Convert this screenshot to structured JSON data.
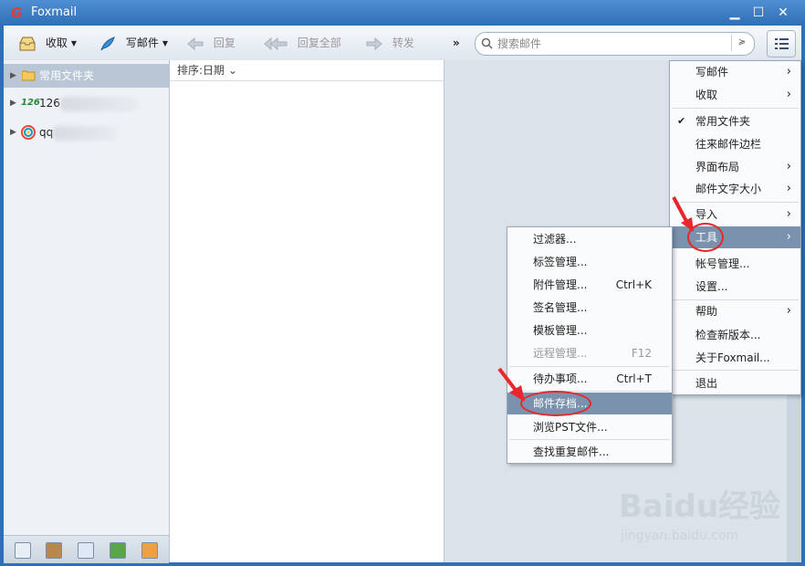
{
  "window": {
    "title": "Foxmail",
    "logo_glyph": "G",
    "controls": {
      "minimize": "▁",
      "maximize": "☐",
      "close": "✕"
    }
  },
  "toolbar": {
    "receive": "收取",
    "compose": "写邮件",
    "reply": "回复",
    "reply_all": "回复全部",
    "forward": "转发",
    "more": "»",
    "search_placeholder": "搜索邮件",
    "search_dropdown": "≽"
  },
  "folders": [
    {
      "label": "常用文件夹",
      "icon": "folder-icon",
      "selected": true
    },
    {
      "label": "126",
      "icon": "126-account-icon",
      "prefix": "126"
    },
    {
      "label": "qq",
      "icon": "qq-account-icon"
    }
  ],
  "list": {
    "sort_label": "排序:日期",
    "sort_caret": "⌄"
  },
  "main_menu": [
    {
      "label": "写邮件",
      "submenu": true
    },
    {
      "label": "收取",
      "submenu": true
    },
    {
      "label": "常用文件夹",
      "checked": true
    },
    {
      "label": "往来邮件边栏"
    },
    {
      "label": "界面布局",
      "submenu": true
    },
    {
      "label": "邮件文字大小",
      "submenu": true
    },
    {
      "label": "导入",
      "submenu": true
    },
    {
      "label": "工具",
      "submenu": true,
      "highlighted": true
    },
    {
      "label": "帐号管理..."
    },
    {
      "label": "设置..."
    },
    {
      "label": "帮助",
      "submenu": true
    },
    {
      "label": "检查新版本..."
    },
    {
      "label": "关于Foxmail..."
    },
    {
      "label": "退出"
    }
  ],
  "tools_menu": [
    {
      "label": "过滤器..."
    },
    {
      "label": "标签管理..."
    },
    {
      "label": "附件管理...",
      "shortcut": "Ctrl+K"
    },
    {
      "label": "签名管理..."
    },
    {
      "label": "模板管理..."
    },
    {
      "label": "远程管理...",
      "shortcut": "F12",
      "disabled": true
    },
    {
      "label": "待办事项...",
      "shortcut": "Ctrl+T"
    },
    {
      "label": "邮件存档...",
      "highlighted": true
    },
    {
      "label": "浏览PST文件..."
    },
    {
      "label": "查找重复邮件..."
    }
  ],
  "watermark": {
    "logo": "Baidu经验",
    "url": "jingyan.baidu.com"
  },
  "colors": {
    "accent": "#2f6fb5",
    "highlight": "#7a92ad",
    "annotation": "#e8262b"
  }
}
